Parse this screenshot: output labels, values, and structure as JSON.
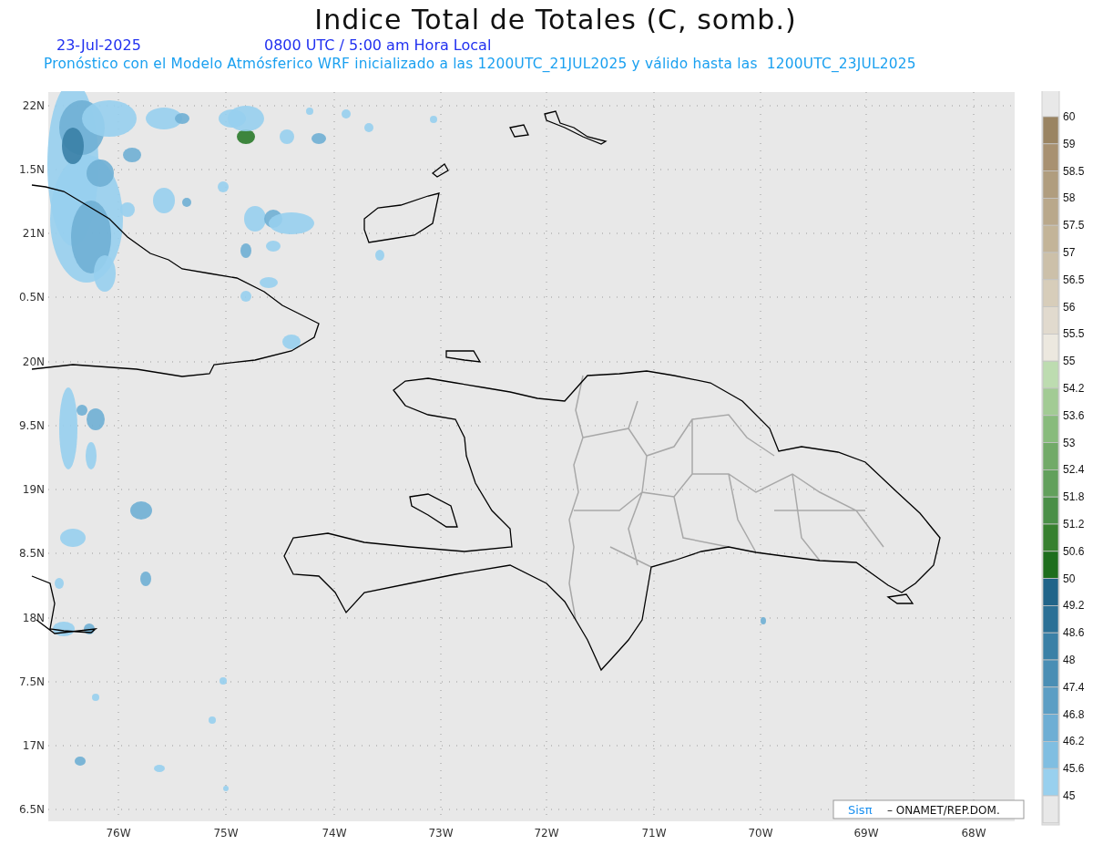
{
  "title": "Indice Total de Totales (C, somb.)",
  "date": "23-Jul-2025",
  "time": "0800 UTC / 5:00 am Hora Local",
  "subtitle": "Pronóstico con el Modelo Atmósferico WRF inicializado a las 1200UTC_21JUL2025 y válido hasta las  1200UTC_23JUL2025",
  "map": {
    "y_labels": [
      "22N",
      "1.5N",
      "21N",
      "0.5N",
      "20N",
      "9.5N",
      "19N",
      "8.5N",
      "18N",
      "7.5N",
      "17N",
      "6.5N"
    ],
    "x_labels": [
      "76W",
      "75W",
      "74W",
      "73W",
      "72W",
      "71W",
      "70W",
      "69W",
      "68W"
    ]
  },
  "legend": {
    "levels": [
      {
        "label": "60",
        "color": "#9a8462"
      },
      {
        "label": "59",
        "color": "#a89171"
      },
      {
        "label": "58.5",
        "color": "#b09d7e"
      },
      {
        "label": "58",
        "color": "#b9a88b"
      },
      {
        "label": "57.5",
        "color": "#c3b498"
      },
      {
        "label": "57",
        "color": "#ccc0a9"
      },
      {
        "label": "56.5",
        "color": "#d7cdba"
      },
      {
        "label": "56",
        "color": "#e1dace"
      },
      {
        "label": "55.5",
        "color": "#ece8df"
      },
      {
        "label": "55",
        "color": "#bddcb0"
      },
      {
        "label": "54.2",
        "color": "#a2cb94"
      },
      {
        "label": "53.6",
        "color": "#88bb7c"
      },
      {
        "label": "53",
        "color": "#72aa68"
      },
      {
        "label": "52.4",
        "color": "#62a05c"
      },
      {
        "label": "51.8",
        "color": "#4a8f47"
      },
      {
        "label": "51.2",
        "color": "#37802f"
      },
      {
        "label": "50.6",
        "color": "#1e6e1d"
      },
      {
        "label": "50",
        "color": "#206489"
      },
      {
        "label": "49.2",
        "color": "#2b7096"
      },
      {
        "label": "48.6",
        "color": "#3a80a6"
      },
      {
        "label": "48",
        "color": "#4a8eb4"
      },
      {
        "label": "47.4",
        "color": "#5c9ec4"
      },
      {
        "label": "46.8",
        "color": "#6eaed4"
      },
      {
        "label": "46.2",
        "color": "#80bee1"
      },
      {
        "label": "45.6",
        "color": "#98d0ee"
      },
      {
        "label": "45",
        "color": "#e8e8e8"
      }
    ]
  },
  "credit": {
    "brand": "Sisπ",
    "text": "– ONAMET/REP.DOM."
  }
}
